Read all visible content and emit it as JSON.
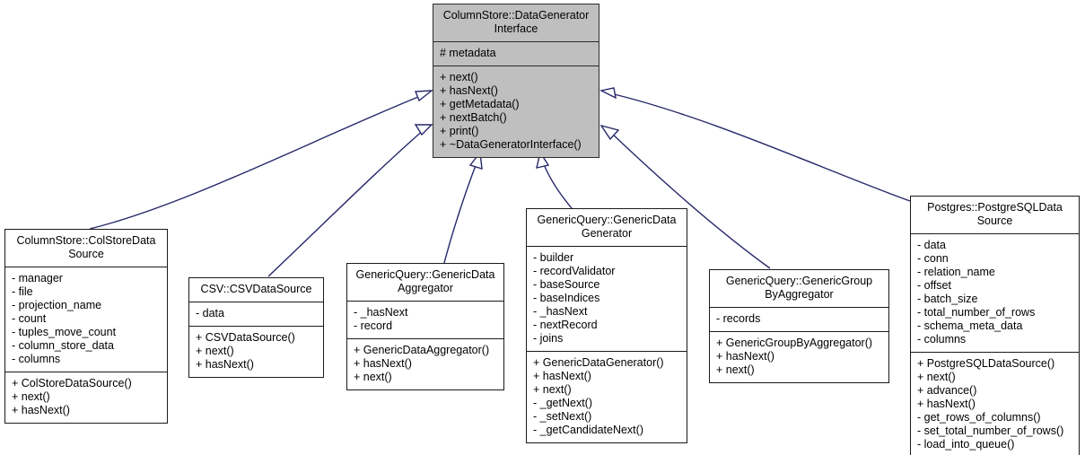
{
  "diagram": {
    "kind": "uml-class-inheritance-diagram",
    "background_color": "#ffffff",
    "edge_color": "#27286b",
    "root_fill_color": "#bfbfbf",
    "border_color": "#1a1a1a",
    "relationship": "generalization"
  },
  "classes": {
    "root": {
      "title": "ColumnStore::DataGenerator\nInterface",
      "attributes": [
        "# metadata"
      ],
      "operations": [
        "+ next()",
        "+ hasNext()",
        "+ getMetadata()",
        "+ nextBatch()",
        "+ print()",
        "+ ~DataGeneratorInterface()"
      ]
    },
    "colstore": {
      "title": "ColumnStore::ColStoreData\nSource",
      "attributes": [
        "- manager",
        "- file",
        "- projection_name",
        "- count",
        "- tuples_move_count",
        "- column_store_data",
        "- columns"
      ],
      "operations": [
        "+ ColStoreDataSource()",
        "+ next()",
        "+ hasNext()"
      ]
    },
    "csv": {
      "title": "CSV::CSVDataSource",
      "attributes": [
        "- data"
      ],
      "operations": [
        "+ CSVDataSource()",
        "+ next()",
        "+ hasNext()"
      ]
    },
    "aggregator": {
      "title": "GenericQuery::GenericData\nAggregator",
      "attributes": [
        "- _hasNext",
        "- record"
      ],
      "operations": [
        "+ GenericDataAggregator()",
        "+ hasNext()",
        "+ next()"
      ]
    },
    "generator": {
      "title": "GenericQuery::GenericData\nGenerator",
      "attributes": [
        "- builder",
        "- recordValidator",
        "- baseSource",
        "- baseIndices",
        "- _hasNext",
        "- nextRecord",
        "- joins"
      ],
      "operations": [
        "+ GenericDataGenerator()",
        "+ hasNext()",
        "+ next()",
        "- _getNext()",
        "- _setNext()",
        "- _getCandidateNext()"
      ]
    },
    "groupby": {
      "title": "GenericQuery::GenericGroup\nByAggregator",
      "attributes": [
        "- records"
      ],
      "operations": [
        "+ GenericGroupByAggregator()",
        "+ hasNext()",
        "+ next()"
      ]
    },
    "postgres": {
      "title": "Postgres::PostgreSQLData\nSource",
      "attributes": [
        "- data",
        "- conn",
        "- relation_name",
        "- offset",
        "- batch_size",
        "- total_number_of_rows",
        "- schema_meta_data",
        "- columns"
      ],
      "operations": [
        "+ PostgreSQLDataSource()",
        "+ next()",
        "+ advance()",
        "+ hasNext()",
        "- get_rows_of_columns()",
        "- set_total_number_of_rows()",
        "- load_into_queue()"
      ]
    }
  },
  "edges": [
    {
      "from": "colstore",
      "to": "root"
    },
    {
      "from": "csv",
      "to": "root"
    },
    {
      "from": "aggregator",
      "to": "root"
    },
    {
      "from": "generator",
      "to": "root"
    },
    {
      "from": "groupby",
      "to": "root"
    },
    {
      "from": "postgres",
      "to": "root"
    }
  ]
}
